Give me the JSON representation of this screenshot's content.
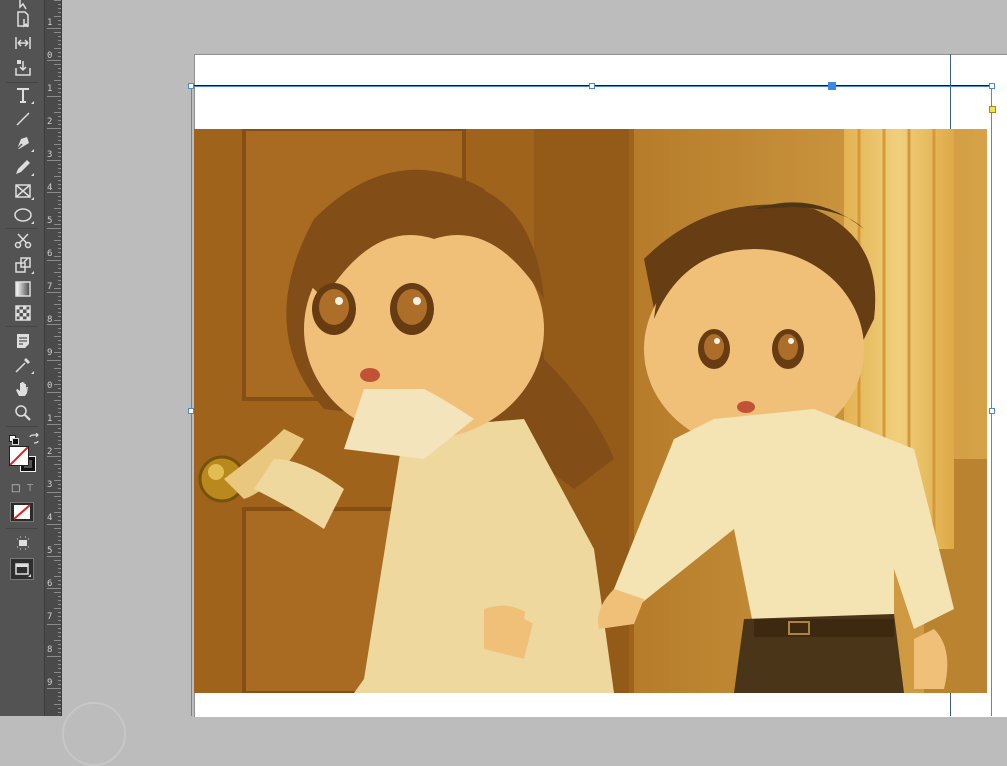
{
  "tools": [
    {
      "name": "direct-selection-tool",
      "icon": "direct-select-arrow-icon"
    },
    {
      "name": "page-tool",
      "icon": "page-icon"
    },
    {
      "name": "gap-tool",
      "icon": "gap-icon"
    },
    {
      "name": "content-collector-tool",
      "icon": "content-collector-icon"
    },
    {
      "name": "type-tool",
      "icon": "type-icon"
    },
    {
      "name": "line-tool",
      "icon": "line-icon"
    },
    {
      "name": "pen-tool",
      "icon": "pen-icon"
    },
    {
      "name": "pencil-tool",
      "icon": "pencil-icon"
    },
    {
      "name": "rectangle-frame-tool",
      "icon": "rectangle-frame-icon"
    },
    {
      "name": "ellipse-tool",
      "icon": "ellipse-icon"
    },
    {
      "name": "scissors-tool",
      "icon": "scissors-icon"
    },
    {
      "name": "free-transform-tool",
      "icon": "free-transform-icon"
    },
    {
      "name": "gradient-swatch-tool",
      "icon": "gradient-icon"
    },
    {
      "name": "gradient-feather-tool",
      "icon": "gradient-feather-icon"
    },
    {
      "name": "note-tool",
      "icon": "note-icon"
    },
    {
      "name": "eyedropper-tool",
      "icon": "eyedropper-icon"
    },
    {
      "name": "hand-tool",
      "icon": "hand-icon"
    },
    {
      "name": "zoom-tool",
      "icon": "zoom-icon"
    }
  ],
  "ruler": {
    "labels": [
      "1",
      "0",
      "1",
      "2",
      "3",
      "4",
      "5",
      "6",
      "7",
      "8",
      "9",
      "0",
      "1",
      "2",
      "3",
      "4",
      "5",
      "6",
      "7",
      "8",
      "9"
    ]
  },
  "formatting_toggle": {
    "container": "□",
    "text": "T"
  },
  "colors": {
    "selection": "#4a8ad8",
    "panel": "#535353",
    "pasteboard": "#bcbcbc"
  },
  "image": {
    "description_icon": "illustration-two-children-icon"
  }
}
